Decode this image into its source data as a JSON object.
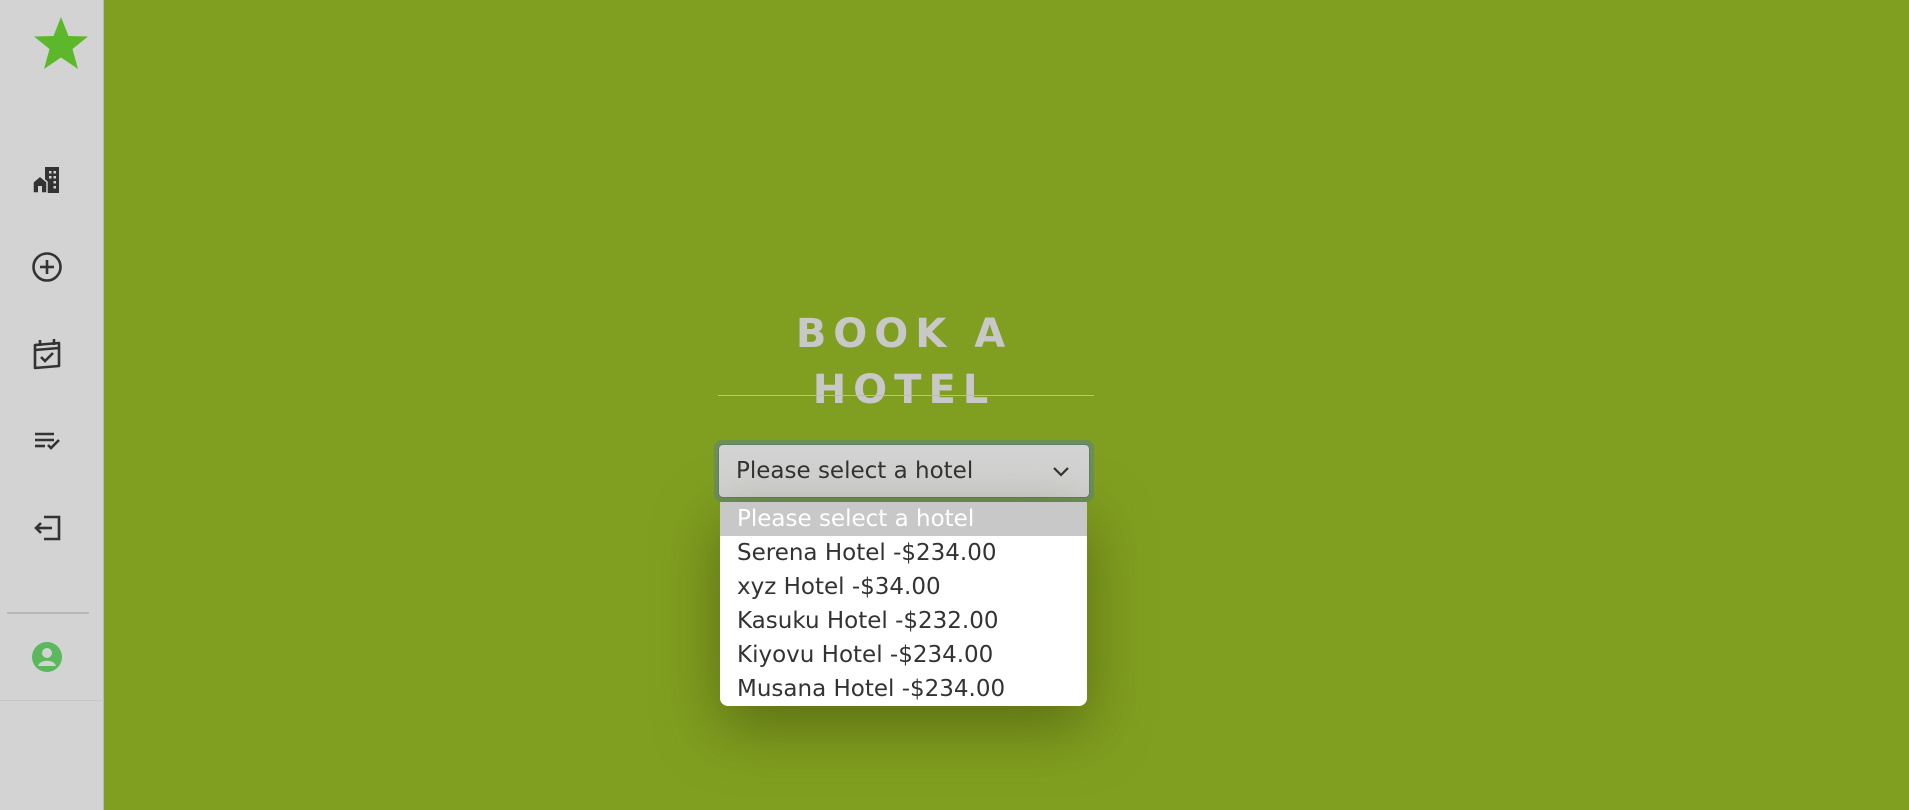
{
  "sidebar": {
    "logo_icon": "star-icon",
    "nav_items": [
      {
        "icon": "hotel-building-icon"
      },
      {
        "icon": "add-circle-icon"
      },
      {
        "icon": "calendar-check-icon"
      },
      {
        "icon": "list-check-icon"
      },
      {
        "icon": "logout-icon"
      }
    ],
    "profile_icon": "user-avatar-icon"
  },
  "main": {
    "title": "BOOK A HOTEL",
    "select": {
      "selected": "Please select a hotel",
      "options": [
        "Please select a hotel",
        "Serena Hotel -$234.00",
        "xyz Hotel -$34.00",
        "Kasuku Hotel -$232.00",
        "Kiyovu Hotel -$234.00",
        "Musana Hotel -$234.00"
      ]
    }
  },
  "colors": {
    "background": "#809f20",
    "sidebar": "#d3d3d3",
    "accent_green": "#5cb82a",
    "title": "#c8c8c8"
  }
}
